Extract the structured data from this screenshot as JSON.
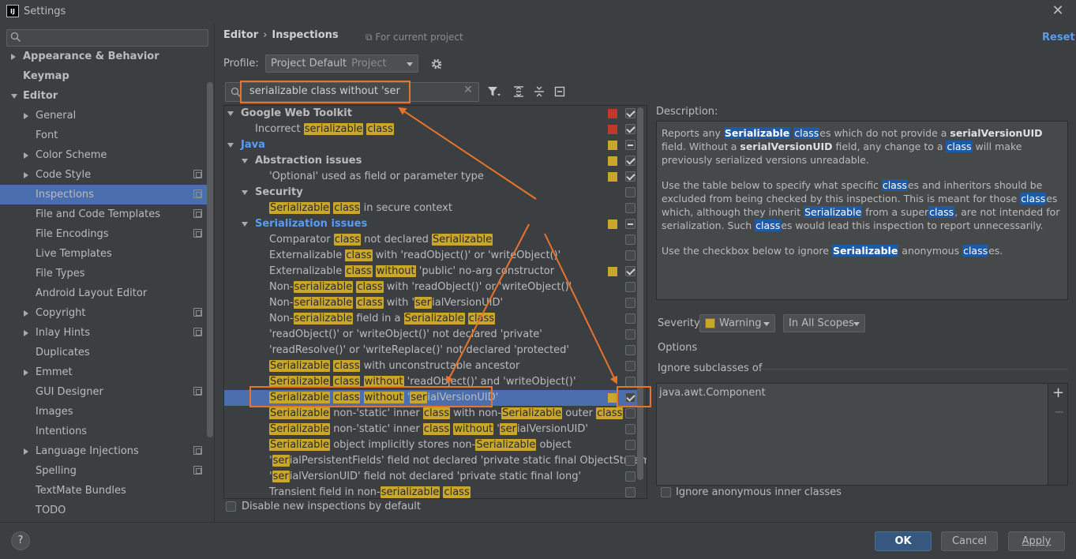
{
  "window": {
    "title": "Settings",
    "logo": "IJ"
  },
  "search": {
    "placeholder": ""
  },
  "sidebar": {
    "items": [
      {
        "label": "Appearance & Behavior",
        "level": 0,
        "arrow": "right",
        "bold": true
      },
      {
        "label": "Keymap",
        "level": 0,
        "bold": true
      },
      {
        "label": "Editor",
        "level": 0,
        "arrow": "down",
        "bold": true
      },
      {
        "label": "General",
        "level": 1,
        "arrow": "right"
      },
      {
        "label": "Font",
        "level": 1
      },
      {
        "label": "Color Scheme",
        "level": 1,
        "arrow": "right"
      },
      {
        "label": "Code Style",
        "level": 1,
        "arrow": "right",
        "proj": true
      },
      {
        "label": "Inspections",
        "level": 1,
        "proj": true,
        "selected": true
      },
      {
        "label": "File and Code Templates",
        "level": 1,
        "proj": true
      },
      {
        "label": "File Encodings",
        "level": 1,
        "proj": true
      },
      {
        "label": "Live Templates",
        "level": 1
      },
      {
        "label": "File Types",
        "level": 1
      },
      {
        "label": "Android Layout Editor",
        "level": 1
      },
      {
        "label": "Copyright",
        "level": 1,
        "arrow": "right",
        "proj": true
      },
      {
        "label": "Inlay Hints",
        "level": 1,
        "arrow": "right",
        "proj": true
      },
      {
        "label": "Duplicates",
        "level": 1
      },
      {
        "label": "Emmet",
        "level": 1,
        "arrow": "right"
      },
      {
        "label": "GUI Designer",
        "level": 1,
        "proj": true
      },
      {
        "label": "Images",
        "level": 1
      },
      {
        "label": "Intentions",
        "level": 1
      },
      {
        "label": "Language Injections",
        "level": 1,
        "arrow": "right",
        "proj": true
      },
      {
        "label": "Spelling",
        "level": 1,
        "proj": true
      },
      {
        "label": "TextMate Bundles",
        "level": 1
      },
      {
        "label": "TODO",
        "level": 1
      }
    ]
  },
  "header": {
    "breadcrumb": [
      "Editor",
      "Inspections"
    ],
    "breadcrumb_sep": "›",
    "for_project": "For current project",
    "reset": "Reset"
  },
  "profile": {
    "label": "Profile:",
    "value": "Project Default",
    "scope": "Project"
  },
  "filter": {
    "value": "serializable class without 'ser",
    "clear": "✕"
  },
  "inspections": [
    {
      "level": 0,
      "arrow": "down",
      "style": "bold",
      "segs": [
        [
          "Google Web Toolkit",
          0
        ]
      ],
      "sev": "#c0392b",
      "cb": "checked"
    },
    {
      "level": 1,
      "segs": [
        [
          "Incorrect ",
          0
        ],
        [
          "serializable",
          1
        ],
        [
          " ",
          0
        ],
        [
          "class",
          1
        ]
      ],
      "sev": "#c0392b",
      "cb": "checked"
    },
    {
      "level": 0,
      "arrow": "down",
      "style": "blue",
      "segs": [
        [
          "Java",
          0
        ]
      ],
      "sev": "#c9a72a",
      "cb": "partial"
    },
    {
      "level": 1,
      "arrow": "down",
      "style": "bold",
      "segs": [
        [
          "Abstraction issues",
          0
        ]
      ],
      "sev": "#c9a72a",
      "cb": "checked"
    },
    {
      "level": 2,
      "segs": [
        [
          "'Optional' used as field or parameter type",
          0
        ]
      ],
      "sev": "#c9a72a",
      "cb": "checked"
    },
    {
      "level": 1,
      "arrow": "down",
      "style": "bold",
      "segs": [
        [
          "Security",
          0
        ]
      ],
      "cb": "none"
    },
    {
      "level": 2,
      "segs": [
        [
          "Serializable",
          1
        ],
        [
          " ",
          0
        ],
        [
          "class",
          1
        ],
        [
          " in secure context",
          0
        ]
      ],
      "cb": "none"
    },
    {
      "level": 1,
      "arrow": "down",
      "style": "blue",
      "segs": [
        [
          "Serialization issues",
          0
        ]
      ],
      "sev": "#c9a72a",
      "cb": "partial"
    },
    {
      "level": 2,
      "segs": [
        [
          "Comparator ",
          0
        ],
        [
          "class",
          1
        ],
        [
          " not declared ",
          0
        ],
        [
          "Serializable",
          1
        ]
      ],
      "cb": "none"
    },
    {
      "level": 2,
      "segs": [
        [
          "Externalizable ",
          0
        ],
        [
          "class",
          1
        ],
        [
          " with 'readObject()' or 'writeObject()'",
          0
        ]
      ],
      "cb": "none"
    },
    {
      "level": 2,
      "segs": [
        [
          "Externalizable ",
          0
        ],
        [
          "class",
          1
        ],
        [
          " ",
          0
        ],
        [
          "without",
          1
        ],
        [
          " 'public' no-arg constructor",
          0
        ]
      ],
      "sev": "#c9a72a",
      "cb": "checked"
    },
    {
      "level": 2,
      "segs": [
        [
          "Non-",
          0
        ],
        [
          "serializable",
          1
        ],
        [
          " ",
          0
        ],
        [
          "class",
          1
        ],
        [
          " with 'readObject()' or 'writeObject()'",
          0
        ]
      ],
      "cb": "none"
    },
    {
      "level": 2,
      "segs": [
        [
          "Non-",
          0
        ],
        [
          "serializable",
          1
        ],
        [
          " ",
          0
        ],
        [
          "class",
          1
        ],
        [
          " with '",
          0
        ],
        [
          "ser",
          1
        ],
        [
          "ialVersionUID'",
          0
        ]
      ],
      "cb": "none"
    },
    {
      "level": 2,
      "segs": [
        [
          "Non-",
          0
        ],
        [
          "serializable",
          1
        ],
        [
          " field in a ",
          0
        ],
        [
          "Serializable",
          1
        ],
        [
          " ",
          0
        ],
        [
          "class",
          1
        ]
      ],
      "cb": "none"
    },
    {
      "level": 2,
      "segs": [
        [
          "'readObject()' or 'writeObject()' not declared 'private'",
          0
        ]
      ],
      "cb": "none"
    },
    {
      "level": 2,
      "segs": [
        [
          "'readResolve()' or 'writeReplace()' not declared 'protected'",
          0
        ]
      ],
      "cb": "none"
    },
    {
      "level": 2,
      "segs": [
        [
          "Serializable",
          1
        ],
        [
          " ",
          0
        ],
        [
          "class",
          1
        ],
        [
          " with unconstructable ancestor",
          0
        ]
      ],
      "cb": "none"
    },
    {
      "level": 2,
      "segs": [
        [
          "Serializable",
          1
        ],
        [
          " ",
          0
        ],
        [
          "class",
          1
        ],
        [
          " ",
          0
        ],
        [
          "without",
          1
        ],
        [
          " 'readObject()' and 'writeObject()'",
          0
        ]
      ],
      "cb": "none"
    },
    {
      "level": 2,
      "selected": true,
      "segs": [
        [
          "Serializable",
          1
        ],
        [
          " ",
          0
        ],
        [
          "class",
          1
        ],
        [
          " ",
          0
        ],
        [
          "without",
          1
        ],
        [
          " '",
          0
        ],
        [
          "ser",
          1
        ],
        [
          "ialVersionUID'",
          0
        ]
      ],
      "sev": "#c9a72a",
      "cb": "checked"
    },
    {
      "level": 2,
      "segs": [
        [
          "Serializable",
          1
        ],
        [
          " non-'static' inner ",
          0
        ],
        [
          "class",
          1
        ],
        [
          " with non-",
          0
        ],
        [
          "Serializable",
          1
        ],
        [
          " outer ",
          0
        ],
        [
          "class",
          1
        ]
      ],
      "cb": "none"
    },
    {
      "level": 2,
      "segs": [
        [
          "Serializable",
          1
        ],
        [
          " non-'static' inner ",
          0
        ],
        [
          "class",
          1
        ],
        [
          " ",
          0
        ],
        [
          "without",
          1
        ],
        [
          " '",
          0
        ],
        [
          "ser",
          1
        ],
        [
          "ialVersionUID'",
          0
        ]
      ],
      "cb": "none"
    },
    {
      "level": 2,
      "segs": [
        [
          "Serializable",
          1
        ],
        [
          " object implicitly stores non-",
          0
        ],
        [
          "Serializable",
          1
        ],
        [
          " object",
          0
        ]
      ],
      "cb": "none"
    },
    {
      "level": 2,
      "segs": [
        [
          "'",
          0
        ],
        [
          "ser",
          1
        ],
        [
          "ialPersistentFields' field not declared 'private static final ObjectStream",
          0
        ]
      ],
      "cb": "none"
    },
    {
      "level": 2,
      "segs": [
        [
          "'",
          0
        ],
        [
          "ser",
          1
        ],
        [
          "ialVersionUID' field not declared 'private static final long'",
          0
        ]
      ],
      "cb": "none"
    },
    {
      "level": 2,
      "segs": [
        [
          "Transient field in non-",
          0
        ],
        [
          "serializable",
          1
        ],
        [
          " ",
          0
        ],
        [
          "class",
          1
        ]
      ],
      "cb": "none"
    }
  ],
  "disable_new": {
    "label": "Disable new inspections by default"
  },
  "description": {
    "label": "Description:",
    "paragraphs": [
      [
        [
          "Reports any ",
          0
        ],
        [
          "Serializable",
          2
        ],
        [
          " ",
          0
        ],
        [
          "class",
          1
        ],
        [
          "es which do not provide a ",
          0
        ],
        [
          "serialVersionUID",
          3
        ],
        [
          " field. Without a ",
          0
        ],
        [
          "serialVersionUID",
          3
        ],
        [
          " field, any change to a ",
          0
        ],
        [
          "class",
          1
        ],
        [
          " will make previously serialized versions unreadable.",
          0
        ]
      ],
      [
        [
          "Use the table below to specify what specific ",
          0
        ],
        [
          "class",
          1
        ],
        [
          "es and inheritors should be excluded from being checked by this inspection. This is meant for those ",
          0
        ],
        [
          "class",
          1
        ],
        [
          "es which, although they inherit ",
          0
        ],
        [
          "Serializable",
          1
        ],
        [
          " from a super",
          0
        ],
        [
          "class",
          1
        ],
        [
          ", are not intended for serialization. Such ",
          0
        ],
        [
          "class",
          1
        ],
        [
          "es would lead this inspection to report unnecessarily.",
          0
        ]
      ],
      [
        [
          "Use the checkbox below to ignore ",
          0
        ],
        [
          "Serializable",
          2
        ],
        [
          " anonymous ",
          0
        ],
        [
          "class",
          1
        ],
        [
          "es.",
          0
        ]
      ]
    ]
  },
  "severity": {
    "label": "Severity:",
    "value": "Warning",
    "scope": "In All Scopes",
    "color": "#c9a72a"
  },
  "options": {
    "label": "Options",
    "ignore_subclasses": "Ignore subclasses of",
    "classes": [
      "java.awt.Component"
    ],
    "add": "+",
    "remove": "−",
    "ignore_anonymous": "Ignore anonymous inner classes"
  },
  "buttons": {
    "help": "?",
    "ok": "OK",
    "cancel": "Cancel",
    "apply": "Apply"
  },
  "colors": {
    "accent": "#4b6eaf",
    "highlight": "#c9a72a",
    "annotation": "#e8742c",
    "link": "#589df6"
  }
}
